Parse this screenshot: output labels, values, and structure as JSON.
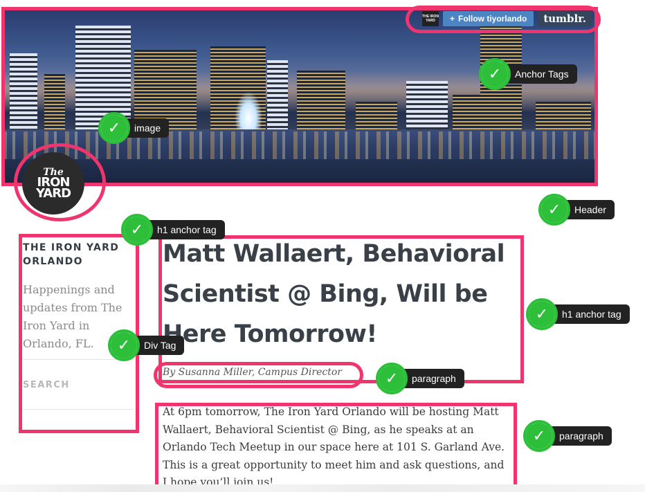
{
  "header": {
    "follow_label": "Follow tiyorlando",
    "follow_icon": "plus-icon",
    "tumblr_logo": "tumblr.",
    "mini_logo_text": "THE IRON YARD"
  },
  "logo": {
    "line1": "The",
    "line2": "IRON",
    "line3": "YARD"
  },
  "sidebar": {
    "title": "THE IRON YARD ORLANDO",
    "description": "Happenings and updates from The Iron Yard in Orlando, FL.",
    "search_label": "SEARCH"
  },
  "post": {
    "title": "Matt Wallaert, Behavioral Scientist @ Bing, Will be Here Tomorrow!",
    "byline": "By Susanna Miller, Campus Director",
    "body": "At 6pm tomorrow, The Iron Yard Orlando will be hosting Matt Wallaert, Behavioral Scientist @ Bing, as he speaks at an Orlando Tech Meetup in our space here at 101 S. Garland Ave. This is a great opportunity to meet him and ask questions, and I hope you’ll join us!"
  },
  "annotations": {
    "anchor_tags": "Anchor Tags",
    "image": "image",
    "header": "Header",
    "h1_anchor_tag_1": "h1 anchor tag",
    "h1_anchor_tag_2": "h1 anchor tag",
    "div_tag": "Div Tag",
    "paragraph_1": "paragraph",
    "paragraph_2": "paragraph",
    "check_glyph": "✓"
  },
  "colors": {
    "outline": "#f0346d",
    "check_green": "#2dbf3a",
    "label_bg": "#222222",
    "follow_blue": "#4c85c3",
    "tumblr_navy": "#35465c"
  }
}
